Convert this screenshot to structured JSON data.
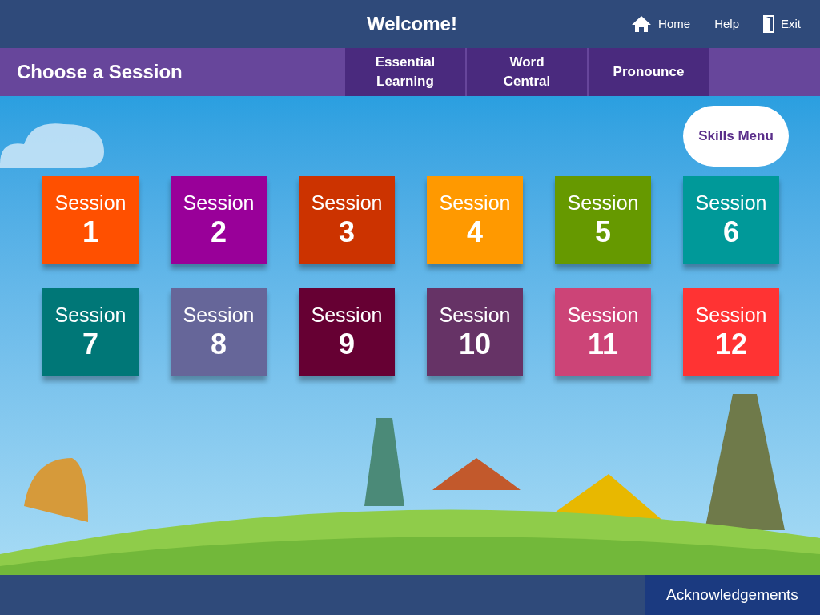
{
  "header": {
    "title": "Welcome!",
    "links": [
      {
        "kind": "home",
        "label": "Home"
      },
      {
        "kind": "help",
        "label": "Help"
      },
      {
        "kind": "exit",
        "label": "Exit"
      }
    ]
  },
  "subheader": {
    "title": "Choose a Session",
    "tabs": [
      {
        "label": "Essential\nLearning",
        "selected": false
      },
      {
        "label": "Word\nCentral",
        "selected": false
      },
      {
        "label": "Pronounce",
        "selected": false
      }
    ]
  },
  "skills_menu": "Skills Menu",
  "sessions": [
    {
      "label": "Session",
      "number": "1",
      "color": "#ff5000"
    },
    {
      "label": "Session",
      "number": "2",
      "color": "#990099"
    },
    {
      "label": "Session",
      "number": "3",
      "color": "#cc3300"
    },
    {
      "label": "Session",
      "number": "4",
      "color": "#ff9900"
    },
    {
      "label": "Session",
      "number": "5",
      "color": "#669900"
    },
    {
      "label": "Session",
      "number": "6",
      "color": "#009999"
    },
    {
      "label": "Session",
      "number": "7",
      "color": "#007777"
    },
    {
      "label": "Session",
      "number": "8",
      "color": "#666699"
    },
    {
      "label": "Session",
      "number": "9",
      "color": "#660033"
    },
    {
      "label": "Session",
      "number": "10",
      "color": "#663366"
    },
    {
      "label": "Session",
      "number": "11",
      "color": "#cc4477"
    },
    {
      "label": "Session",
      "number": "12",
      "color": "#ff3333"
    }
  ],
  "footer": {
    "button": "Acknowledgements"
  }
}
